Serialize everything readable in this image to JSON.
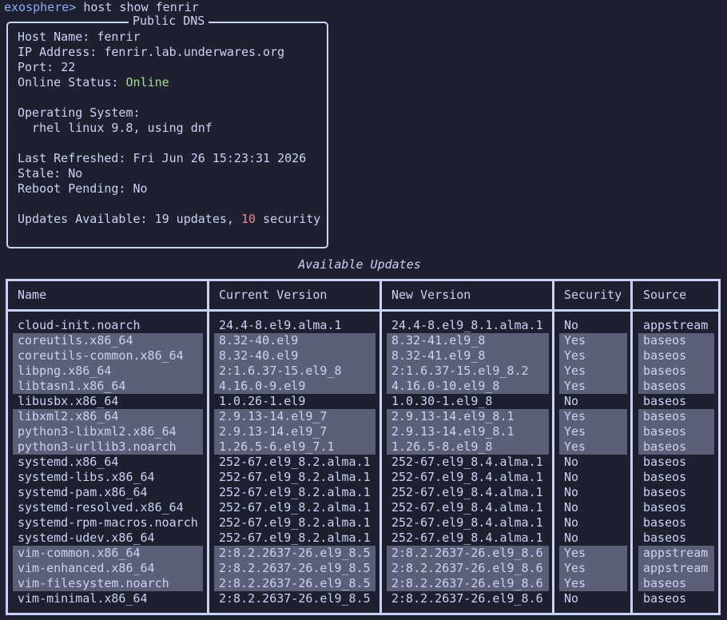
{
  "terminal": {
    "prompt": "exosphere>",
    "command": " host show fenrir"
  },
  "panel": {
    "title": "Public DNS",
    "host_name_label": "Host Name: ",
    "host_name": "fenrir",
    "ip_label": "IP Address: ",
    "ip": "fenrir.lab.underwares.org",
    "port_label": "Port: ",
    "port": "22",
    "status_label": "Online Status: ",
    "status": "Online",
    "os_label": "Operating System:",
    "os": "  rhel linux 9.8, using dnf",
    "refreshed_label": "Last Refreshed: ",
    "refreshed": "Fri Jun 26 15:23:31 2026",
    "stale_label": "Stale: ",
    "stale": "No",
    "reboot_label": "Reboot Pending: ",
    "reboot": "No",
    "updates_label": "Updates Available: ",
    "updates_count": "19 updates, ",
    "security_count": "10",
    "security_suffix": " security"
  },
  "table": {
    "caption": "Available Updates",
    "headers": [
      "Name",
      "Current Version",
      "New Version",
      "Security",
      "Source"
    ],
    "rows": [
      {
        "name": "cloud-init.noarch",
        "current": "24.4-8.el9.alma.1",
        "new": "24.4-8.el9_8.1.alma.1",
        "security": "No",
        "source": "appstream"
      },
      {
        "name": "coreutils.x86_64",
        "current": "8.32-40.el9",
        "new": "8.32-41.el9_8",
        "security": "Yes",
        "source": "baseos"
      },
      {
        "name": "coreutils-common.x86_64",
        "current": "8.32-40.el9",
        "new": "8.32-41.el9_8",
        "security": "Yes",
        "source": "baseos"
      },
      {
        "name": "libpng.x86_64",
        "current": "2:1.6.37-15.el9_8",
        "new": "2:1.6.37-15.el9_8.2",
        "security": "Yes",
        "source": "baseos"
      },
      {
        "name": "libtasn1.x86_64",
        "current": "4.16.0-9.el9",
        "new": "4.16.0-10.el9_8",
        "security": "Yes",
        "source": "baseos"
      },
      {
        "name": "libusbx.x86_64",
        "current": "1.0.26-1.el9",
        "new": "1.0.30-1.el9_8",
        "security": "No",
        "source": "baseos"
      },
      {
        "name": "libxml2.x86_64",
        "current": "2.9.13-14.el9_7",
        "new": "2.9.13-14.el9_8.1",
        "security": "Yes",
        "source": "baseos"
      },
      {
        "name": "python3-libxml2.x86_64",
        "current": "2.9.13-14.el9_7",
        "new": "2.9.13-14.el9_8.1",
        "security": "Yes",
        "source": "baseos"
      },
      {
        "name": "python3-urllib3.noarch",
        "current": "1.26.5-6.el9_7.1",
        "new": "1.26.5-8.el9_8",
        "security": "Yes",
        "source": "baseos"
      },
      {
        "name": "systemd.x86_64",
        "current": "252-67.el9_8.2.alma.1",
        "new": "252-67.el9_8.4.alma.1",
        "security": "No",
        "source": "baseos"
      },
      {
        "name": "systemd-libs.x86_64",
        "current": "252-67.el9_8.2.alma.1",
        "new": "252-67.el9_8.4.alma.1",
        "security": "No",
        "source": "baseos"
      },
      {
        "name": "systemd-pam.x86_64",
        "current": "252-67.el9_8.2.alma.1",
        "new": "252-67.el9_8.4.alma.1",
        "security": "No",
        "source": "baseos"
      },
      {
        "name": "systemd-resolved.x86_64",
        "current": "252-67.el9_8.2.alma.1",
        "new": "252-67.el9_8.4.alma.1",
        "security": "No",
        "source": "baseos"
      },
      {
        "name": "systemd-rpm-macros.noarch",
        "current": "252-67.el9_8.2.alma.1",
        "new": "252-67.el9_8.4.alma.1",
        "security": "No",
        "source": "baseos"
      },
      {
        "name": "systemd-udev.x86_64",
        "current": "252-67.el9_8.2.alma.1",
        "new": "252-67.el9_8.4.alma.1",
        "security": "No",
        "source": "baseos"
      },
      {
        "name": "vim-common.x86_64",
        "current": "2:8.2.2637-26.el9_8.5",
        "new": "2:8.2.2637-26.el9_8.6",
        "security": "Yes",
        "source": "appstream"
      },
      {
        "name": "vim-enhanced.x86_64",
        "current": "2:8.2.2637-26.el9_8.5",
        "new": "2:8.2.2637-26.el9_8.6",
        "security": "Yes",
        "source": "appstream"
      },
      {
        "name": "vim-filesystem.noarch",
        "current": "2:8.2.2637-26.el9_8.5",
        "new": "2:8.2.2637-26.el9_8.6",
        "security": "Yes",
        "source": "baseos"
      },
      {
        "name": "vim-minimal.x86_64",
        "current": "2:8.2.2637-26.el9_8.5",
        "new": "2:8.2.2637-26.el9_8.6",
        "security": "No",
        "source": "baseos"
      }
    ]
  },
  "colors": {
    "background": "#1e2030",
    "foreground": "#cad3f5",
    "prompt": "#8aadf4",
    "online": "#a6da95",
    "security_count": "#ed8796",
    "row_highlight": "#5b6078"
  }
}
